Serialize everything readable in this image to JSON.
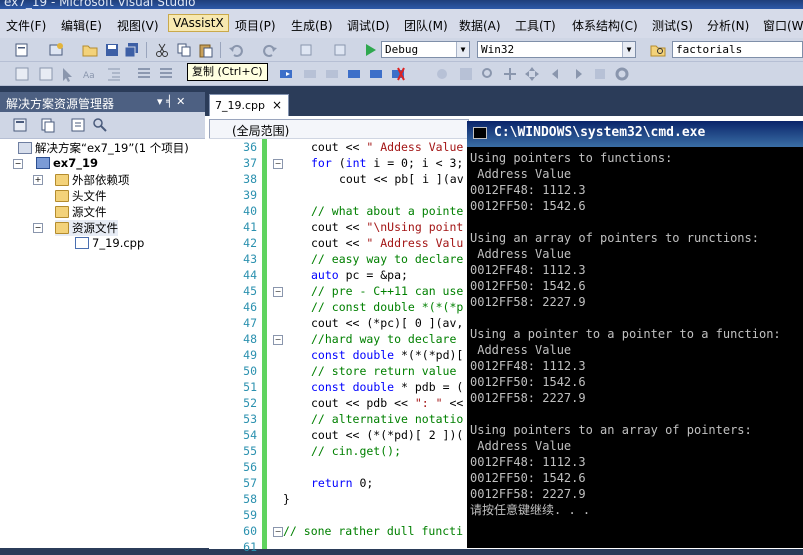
{
  "window": {
    "title": "ex7_19 - Microsoft Visual Studio"
  },
  "menu": [
    "文件(F)",
    "编辑(E)",
    "视图(V)",
    "VAssistX",
    "项目(P)",
    "生成(B)",
    "调试(D)",
    "团队(M)",
    "数据(A)",
    "工具(T)",
    "体系结构(C)",
    "测试(S)",
    "分析(N)",
    "窗口(W)"
  ],
  "toolbar": {
    "config": "Debug",
    "platform": "Win32",
    "find": "factorials",
    "tooltip": "复制 (Ctrl+C)"
  },
  "solution_explorer": {
    "title": "解决方案资源管理器",
    "pin": "▾ ╡ ✕",
    "solution": "解决方案“ex7_19”(1 个项目)",
    "project": "ex7_19",
    "items": [
      "外部依赖项",
      "头文件",
      "源文件",
      "资源文件"
    ],
    "file": "7_19.cpp"
  },
  "editor": {
    "tab": "7_19.cpp",
    "tab_close": "×",
    "scope": "(全局范围)",
    "lines": [
      {
        "n": "36",
        "indent": 1,
        "segs": [
          [
            "t",
            "cout << "
          ],
          [
            "s",
            "\" Addess Value"
          ]
        ]
      },
      {
        "n": "37",
        "indent": 1,
        "segs": [
          [
            "k",
            "for"
          ],
          [
            "t",
            " ("
          ],
          [
            "k",
            "int"
          ],
          [
            "t",
            " i = 0; i < 3;"
          ]
        ]
      },
      {
        "n": "38",
        "indent": 2,
        "segs": [
          [
            "t",
            "cout << pb[ i ](av"
          ]
        ]
      },
      {
        "n": "39",
        "indent": 0,
        "segs": []
      },
      {
        "n": "40",
        "indent": 1,
        "segs": [
          [
            "c",
            "// what about a pointe"
          ]
        ]
      },
      {
        "n": "41",
        "indent": 1,
        "segs": [
          [
            "t",
            "cout << "
          ],
          [
            "s",
            "\"\\nUsing point"
          ]
        ]
      },
      {
        "n": "42",
        "indent": 1,
        "segs": [
          [
            "t",
            "cout << "
          ],
          [
            "s",
            "\" Address Valu"
          ]
        ]
      },
      {
        "n": "43",
        "indent": 1,
        "segs": [
          [
            "c",
            "// easy way to declare"
          ]
        ]
      },
      {
        "n": "44",
        "indent": 1,
        "segs": [
          [
            "k",
            "auto"
          ],
          [
            "t",
            " pc = &pa;"
          ]
        ]
      },
      {
        "n": "45",
        "indent": 1,
        "segs": [
          [
            "c",
            "// pre - C++11 can use"
          ]
        ]
      },
      {
        "n": "46",
        "indent": 1,
        "segs": [
          [
            "c",
            "// const double *(*(*p"
          ]
        ]
      },
      {
        "n": "47",
        "indent": 1,
        "segs": [
          [
            "t",
            "cout << (*pc)[ 0 ](av,"
          ]
        ]
      },
      {
        "n": "48",
        "indent": 1,
        "segs": [
          [
            "c",
            "//hard way to declare"
          ]
        ]
      },
      {
        "n": "49",
        "indent": 1,
        "segs": [
          [
            "k",
            "const"
          ],
          [
            "t",
            " "
          ],
          [
            "k",
            "double"
          ],
          [
            "t",
            " *(*(*pd)["
          ]
        ]
      },
      {
        "n": "50",
        "indent": 1,
        "segs": [
          [
            "c",
            "// store return value"
          ]
        ]
      },
      {
        "n": "51",
        "indent": 1,
        "segs": [
          [
            "k",
            "const"
          ],
          [
            "t",
            " "
          ],
          [
            "k",
            "double"
          ],
          [
            "t",
            " * pdb = ("
          ]
        ]
      },
      {
        "n": "52",
        "indent": 1,
        "segs": [
          [
            "t",
            "cout << pdb << "
          ],
          [
            "s",
            "\": \""
          ],
          [
            "t",
            " <<"
          ]
        ]
      },
      {
        "n": "53",
        "indent": 1,
        "segs": [
          [
            "c",
            "// alternative notatio"
          ]
        ]
      },
      {
        "n": "54",
        "indent": 1,
        "segs": [
          [
            "t",
            "cout << (*(*pd)[ 2 ])("
          ]
        ]
      },
      {
        "n": "55",
        "indent": 1,
        "segs": [
          [
            "c",
            "// cin.get();"
          ]
        ]
      },
      {
        "n": "56",
        "indent": 0,
        "segs": []
      },
      {
        "n": "57",
        "indent": 1,
        "segs": [
          [
            "k",
            "return"
          ],
          [
            "t",
            " 0;"
          ]
        ]
      },
      {
        "n": "58",
        "indent": 0,
        "segs": [
          [
            "t",
            "}"
          ]
        ]
      },
      {
        "n": "59",
        "indent": 0,
        "segs": []
      },
      {
        "n": "60",
        "indent": 0,
        "segs": [
          [
            "c",
            "// sone rather dull functi"
          ]
        ]
      },
      {
        "n": "61",
        "indent": 0,
        "segs": []
      }
    ]
  },
  "console": {
    "title": "C:\\WINDOWS\\system32\\cmd.exe",
    "lines": [
      "Using pointers to functions:",
      " Address Value",
      "0012FF48: 1112.3",
      "0012FF50: 1542.6",
      "",
      "Using an array of pointers to runctions:",
      " Address Value",
      "0012FF48: 1112.3",
      "0012FF50: 1542.6",
      "0012FF58: 2227.9",
      "",
      "Using a pointer to a pointer to a function:",
      " Address Value",
      "0012FF48: 1112.3",
      "0012FF50: 1542.6",
      "0012FF58: 2227.9",
      "",
      "Using pointers to an array of pointers:",
      " Address Value",
      "0012FF48: 1112.3",
      "0012FF50: 1542.6",
      "0012FF58: 2227.9",
      "请按任意键继续. . ."
    ]
  }
}
